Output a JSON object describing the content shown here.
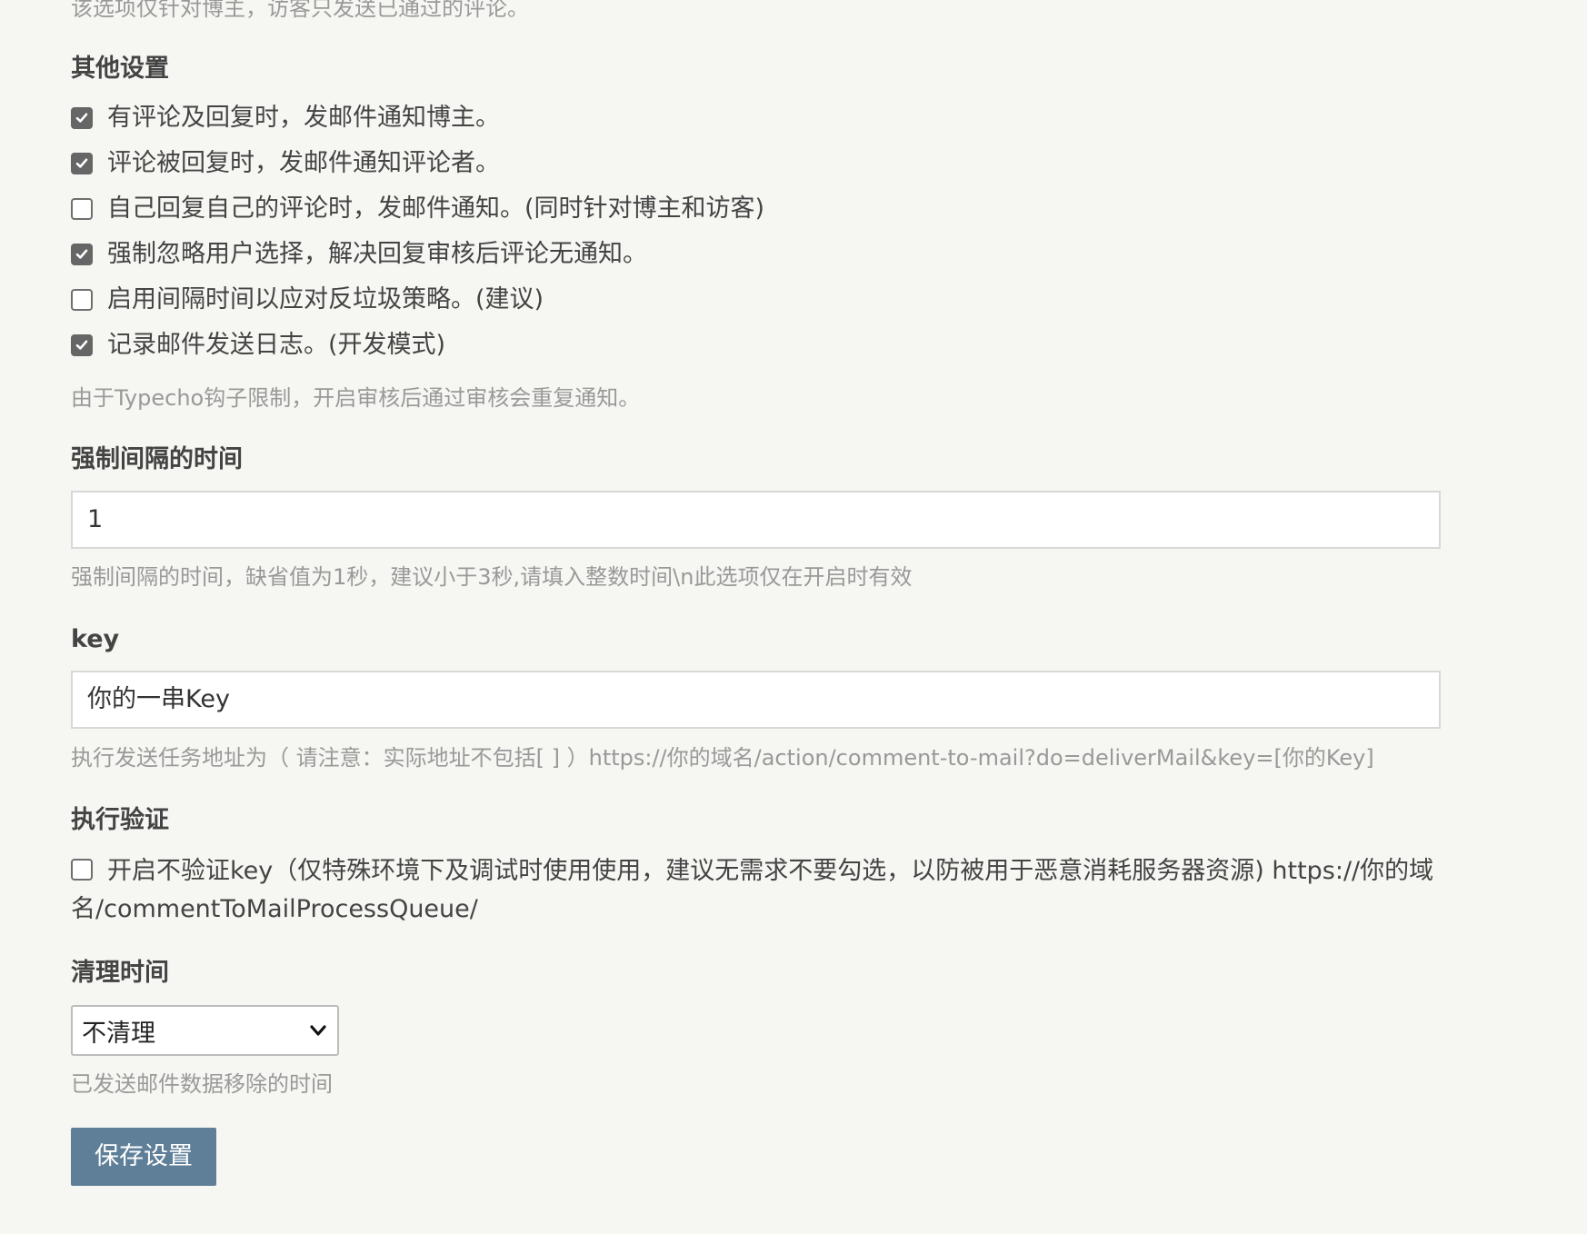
{
  "top_note": "该选项仅针对博主，访客只发送已通过的评论。",
  "other_settings": {
    "title": "其他设置",
    "items": [
      {
        "label": "有评论及回复时，发邮件通知博主。",
        "checked": true
      },
      {
        "label": "评论被回复时，发邮件通知评论者。",
        "checked": true
      },
      {
        "label": "自己回复自己的评论时，发邮件通知。(同时针对博主和访客)",
        "checked": false
      },
      {
        "label": "强制忽略用户选择，解决回复审核后评论无通知。",
        "checked": true
      },
      {
        "label": "启用间隔时间以应对反垃圾策略。(建议)",
        "checked": false
      },
      {
        "label": "记录邮件发送日志。(开发模式)",
        "checked": true
      }
    ],
    "hint": "由于Typecho钩子限制，开启审核后通过审核会重复通知。"
  },
  "interval": {
    "title": "强制间隔的时间",
    "value": "1",
    "hint": "强制间隔的时间，缺省值为1秒，建议小于3秒,请填入整数时间\\n此选项仅在开启时有效"
  },
  "key": {
    "title": "key",
    "value": "你的一串Key",
    "hint": "执行发送任务地址为（ 请注意：实际地址不包括[ ] ）https://你的域名/action/comment-to-mail?do=deliverMail&key=[你的Key]"
  },
  "verify": {
    "title": "执行验证",
    "checked": false,
    "label": "开启不验证key（仅特殊环境下及调试时使用使用，建议无需求不要勾选，以防被用于恶意消耗服务器资源) https://你的域名/commentToMailProcessQueue/"
  },
  "cleanup": {
    "title": "清理时间",
    "selected": "不清理",
    "hint": "已发送邮件数据移除的时间"
  },
  "save_button": "保存设置",
  "icons": {
    "checkbox_checked": "checkmark-icon",
    "select": "chevron-down-icon"
  },
  "colors": {
    "background": "#f6f6f3",
    "button": "#5f7f99",
    "hint_text": "#999999"
  }
}
